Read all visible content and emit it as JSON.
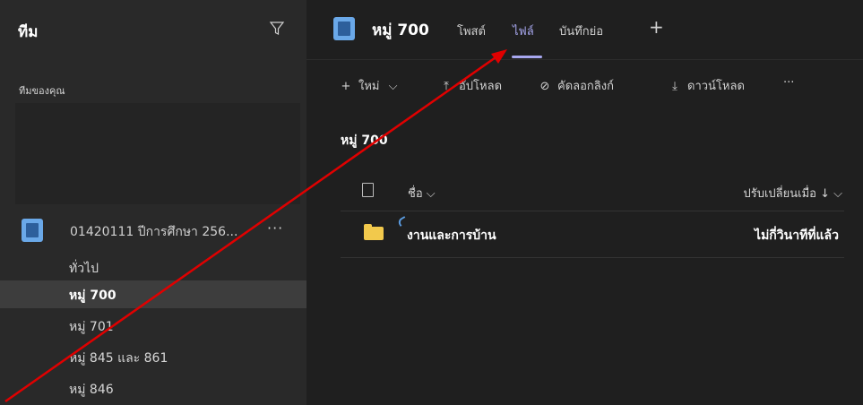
{
  "sidebar": {
    "title": "ทีม",
    "section_label": "ทีมของคุณ",
    "team": {
      "name": "01420111 ปีการศึกษา 256...",
      "more": "···"
    },
    "channels": [
      {
        "label": "ทั่วไป",
        "active": false
      },
      {
        "label": "หมู่ 700",
        "active": true
      },
      {
        "label": "หมู่ 701",
        "active": false
      },
      {
        "label": "หมู่ 845 และ 861",
        "active": false
      },
      {
        "label": "หมู่ 846",
        "active": false
      }
    ]
  },
  "header": {
    "title": "หมู่ 700",
    "tabs": [
      {
        "label": "โพสต์",
        "active": false
      },
      {
        "label": "ไฟล์",
        "active": true
      },
      {
        "label": "บันทึกย่อ",
        "active": false
      }
    ],
    "add": "+"
  },
  "toolbar": {
    "new_label": "ใหม่",
    "upload_label": "อัปโหลด",
    "copy_link_label": "คัดลอกลิงก์",
    "download_label": "ดาวน์โหลด",
    "more": "···"
  },
  "files": {
    "breadcrumb": "หมู่ 700",
    "col_name": "ชื่อ",
    "col_modified": "ปรับเปลี่ยนเมื่อ",
    "rows": [
      {
        "name": "งานและการบ้าน",
        "modified": "ไม่กี่วินาทีที่แล้ว"
      }
    ]
  },
  "colors": {
    "accent": "#a8a8f0",
    "annotation_arrow": "#e00000",
    "folder": "#f2c94c"
  }
}
